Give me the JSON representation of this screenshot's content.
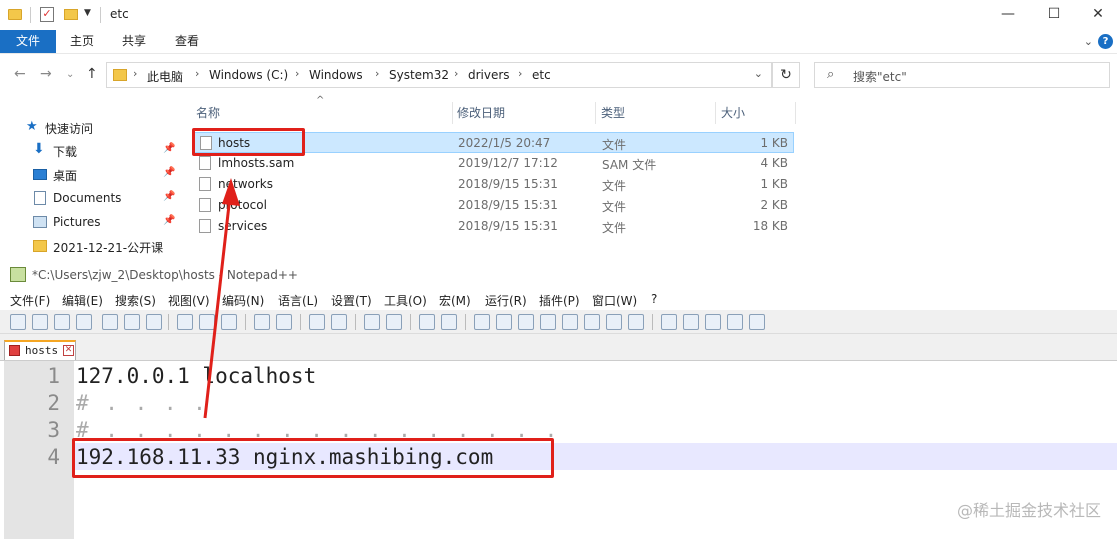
{
  "explorer": {
    "title": "etc",
    "ribbon_tabs": [
      "文件",
      "主页",
      "共享",
      "查看"
    ],
    "breadcrumb": [
      "此电脑",
      "Windows (C:)",
      "Windows",
      "System32",
      "drivers",
      "etc"
    ],
    "search_placeholder": "搜索\"etc\"",
    "sidebar": [
      {
        "label": "快速访问",
        "icon": "star-icon"
      },
      {
        "label": "下载",
        "icon": "download-icon",
        "pinned": true
      },
      {
        "label": "桌面",
        "icon": "desktop-icon",
        "pinned": true
      },
      {
        "label": "Documents",
        "icon": "documents-icon",
        "pinned": true
      },
      {
        "label": "Pictures",
        "icon": "pictures-icon",
        "pinned": true
      },
      {
        "label": "2021-12-21-公开课",
        "icon": "folder-icon"
      }
    ],
    "columns": [
      "名称",
      "修改日期",
      "类型",
      "大小"
    ],
    "files": [
      {
        "name": "hosts",
        "date": "2022/1/5 20:47",
        "type": "文件",
        "size": "1 KB",
        "selected": true
      },
      {
        "name": "lmhosts.sam",
        "date": "2019/12/7 17:12",
        "type": "SAM 文件",
        "size": "4 KB"
      },
      {
        "name": "networks",
        "date": "2018/9/15 15:31",
        "type": "文件",
        "size": "1 KB"
      },
      {
        "name": "protocol",
        "date": "2018/9/15 15:31",
        "type": "文件",
        "size": "2 KB"
      },
      {
        "name": "services",
        "date": "2018/9/15 15:31",
        "type": "文件",
        "size": "18 KB"
      }
    ]
  },
  "notepad": {
    "title": "*C:\\Users\\zjw_2\\Desktop\\hosts - Notepad++",
    "menu": [
      "文件(F)",
      "编辑(E)",
      "搜索(S)",
      "视图(V)",
      "编码(N)",
      "语言(L)",
      "设置(T)",
      "工具(O)",
      "宏(M)",
      "运行(R)",
      "插件(P)",
      "窗口(W)",
      "?"
    ],
    "tab_label": "hosts",
    "lines": [
      {
        "num": "1",
        "text": "127.0.0.1 localhost"
      },
      {
        "num": "2",
        "text": "#    . . . ."
      },
      {
        "num": "3",
        "text": "# . . . . . . . . . . . . . . . ."
      },
      {
        "num": "4",
        "text": "192.168.11.33 nginx.mashibing.com"
      }
    ]
  },
  "watermark": "@稀土掘金技术社区",
  "colors": {
    "accent": "#1a6fc4",
    "highlight": "#e0201a",
    "selection": "#cce8ff"
  }
}
